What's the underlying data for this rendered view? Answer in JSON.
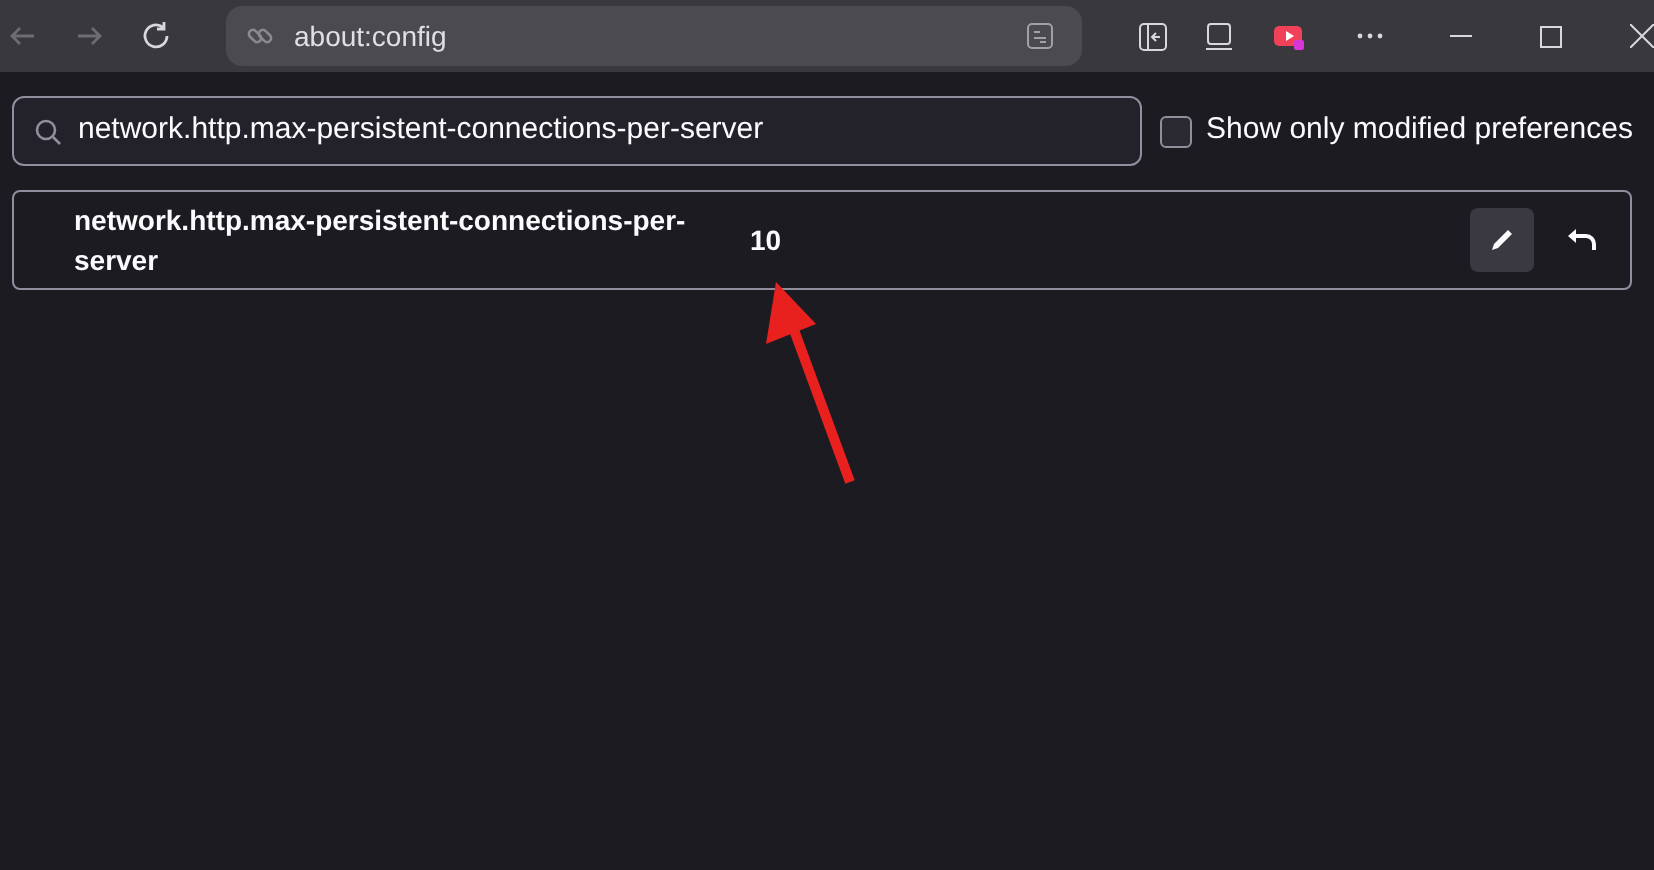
{
  "address_bar": {
    "value": "about:config"
  },
  "search": {
    "value": "network.http.max-persistent-connections-per-server"
  },
  "modified_filter": {
    "label": "Show only modified preferences",
    "checked": false
  },
  "preferences": [
    {
      "name": "network.http.max-persistent-connections-per-server",
      "value": "10",
      "modified": true
    }
  ]
}
